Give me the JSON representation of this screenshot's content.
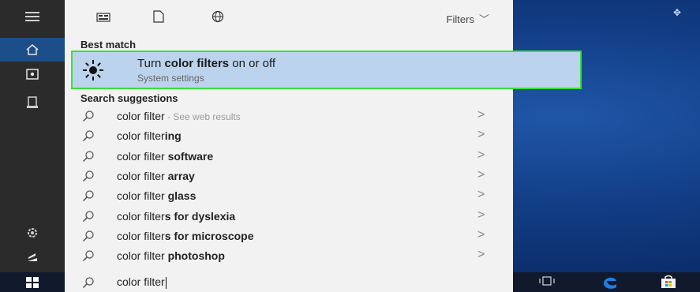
{
  "toolbar": {
    "filters_label": "Filters"
  },
  "sections": {
    "best_match": "Best match",
    "search_suggestions": "Search suggestions"
  },
  "best_match": {
    "title_prefix": "Turn ",
    "title_bold": "color filters",
    "title_suffix": " on or off",
    "subtitle": "System settings"
  },
  "suggestions": [
    {
      "prefix": "color filter",
      "bold": "",
      "hint": " - See web results"
    },
    {
      "prefix": "color filter",
      "bold": "ing",
      "hint": ""
    },
    {
      "prefix": "color filter ",
      "bold": "software",
      "hint": ""
    },
    {
      "prefix": "color filter ",
      "bold": "array",
      "hint": ""
    },
    {
      "prefix": "color filter ",
      "bold": "glass",
      "hint": ""
    },
    {
      "prefix": "color filter",
      "bold": "s for dyslexia",
      "hint": ""
    },
    {
      "prefix": "color filter",
      "bold": "s for microscope",
      "hint": ""
    },
    {
      "prefix": "color filter ",
      "bold": "photoshop",
      "hint": ""
    }
  ],
  "search": {
    "query": "color filter"
  },
  "colors": {
    "highlight": "#bcd3ee",
    "selection_outline": "#3ae03a",
    "edge_blue": "#1e7fe0"
  },
  "icons": {
    "rail": [
      "hamburger-icon",
      "home-icon",
      "settings-app-icon",
      "document-icon",
      "gear-icon",
      "user-icon"
    ],
    "top": [
      "apps-icon",
      "documents-icon",
      "web-icon"
    ],
    "taskbar": [
      "windows-start-icon",
      "task-view-icon",
      "edge-icon",
      "store-icon"
    ]
  }
}
